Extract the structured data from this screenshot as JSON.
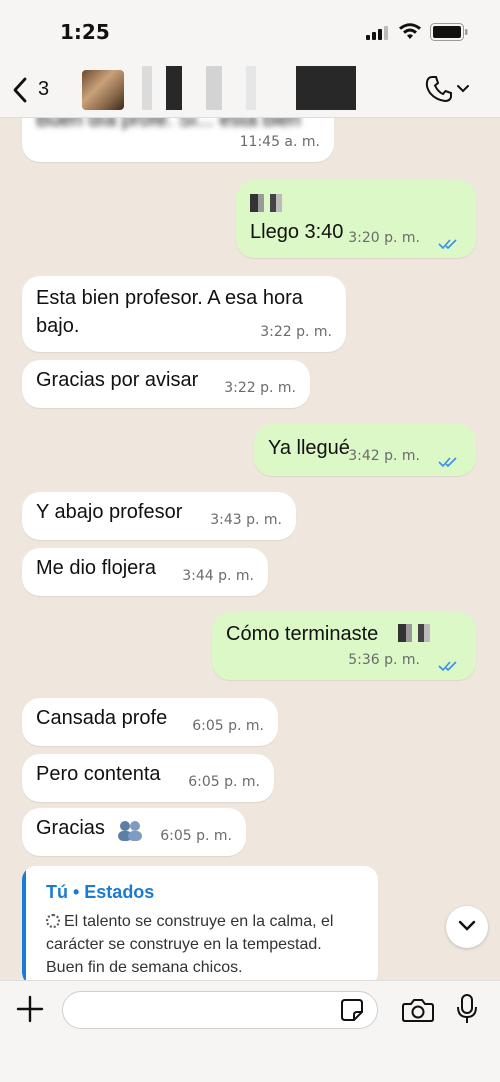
{
  "status_bar": {
    "time": "1:25"
  },
  "header": {
    "back_count": "3"
  },
  "messages": [
    {
      "text": "Buen día profe. Sí... está bien",
      "time": "11:45 a. m."
    },
    {
      "text": "Llego 3:40",
      "time": "3:20 p. m."
    },
    {
      "text": "Esta bien profesor. A esa hora bajo.",
      "time": "3:22 p. m."
    },
    {
      "text": "Gracias por avisar",
      "time": "3:22 p. m."
    },
    {
      "text": "Ya llegué",
      "time": "3:42 p. m."
    },
    {
      "text": "Y abajo profesor",
      "time": "3:43 p. m."
    },
    {
      "text": "Me dio flojera",
      "time": "3:44 p. m."
    },
    {
      "text": "Cómo terminaste",
      "time": "5:36 p. m."
    },
    {
      "text": "Cansada profe",
      "time": "6:05 p. m."
    },
    {
      "text": "Pero contenta",
      "time": "6:05 p. m."
    },
    {
      "text": "Gracias",
      "time": "6:05 p. m."
    }
  ],
  "quote": {
    "header": "Tú • Estados",
    "text": "El talento se construye en la calma, el carácter se construye en la tempestad. Buen fin de semana chicos."
  },
  "composer": {
    "placeholder": ""
  },
  "colors": {
    "incoming": "#ffffff",
    "outgoing": "#dbf8c6",
    "read_ticks": "#3a8ee6"
  }
}
